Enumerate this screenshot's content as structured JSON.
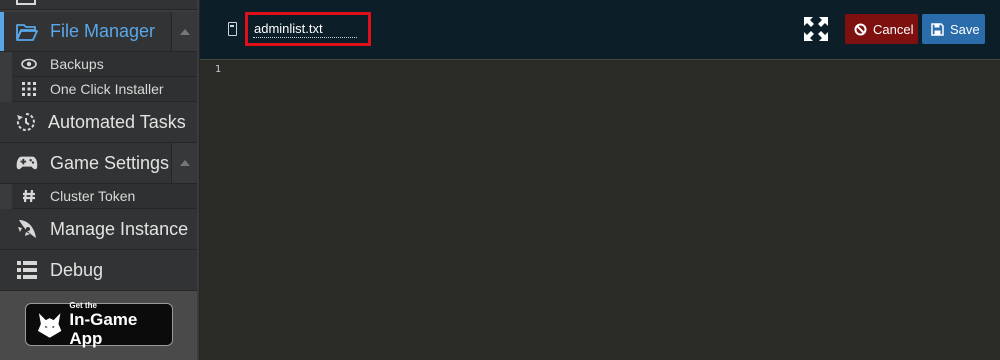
{
  "sidebar": {
    "file_manager": {
      "label": "File Manager"
    },
    "file_manager_sub": [
      {
        "label": "Backups",
        "icon": "eye-icon"
      },
      {
        "label": "One Click Installer",
        "icon": "grid-icon"
      }
    ],
    "automated_tasks": {
      "label": "Automated Tasks"
    },
    "game_settings": {
      "label": "Game Settings"
    },
    "game_settings_sub": [
      {
        "label": "Cluster Token",
        "icon": "hash-icon"
      }
    ],
    "manage_instance": {
      "label": "Manage Instance"
    },
    "debug": {
      "label": "Debug"
    },
    "app_badge": {
      "small": "Get the",
      "big": "In-Game App"
    }
  },
  "toolbar": {
    "filename": "adminlist.txt",
    "cancel_label": "Cancel",
    "save_label": "Save"
  },
  "editor": {
    "line_numbers": [
      "1"
    ]
  },
  "colors": {
    "accent": "#5aa7e8",
    "cancel": "#7e1010",
    "save": "#2b6cab",
    "highlight": "#e0101b"
  }
}
